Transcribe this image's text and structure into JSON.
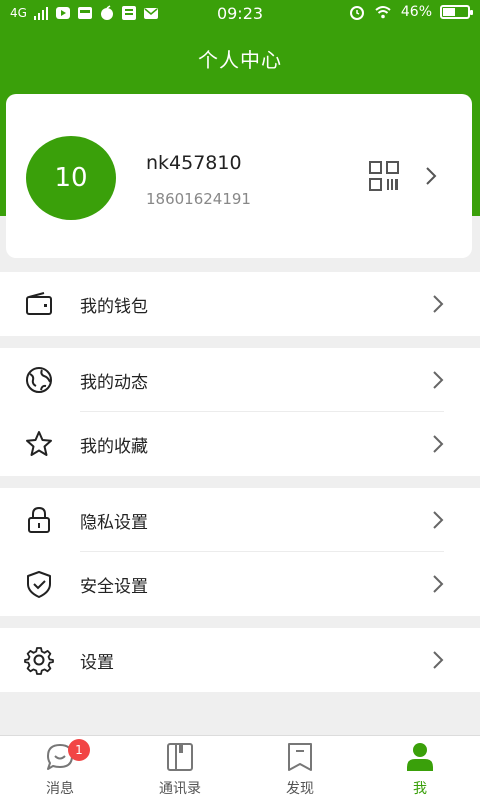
{
  "status_bar": {
    "network": "4G",
    "time": "09:23",
    "battery_percent": "46%"
  },
  "header": {
    "title": "个人中心"
  },
  "profile": {
    "avatar_text": "10",
    "username": "nk457810",
    "phone": "18601624191"
  },
  "menu": {
    "wallet": "我的钱包",
    "moments": "我的动态",
    "favorites": "我的收藏",
    "privacy": "隐私设置",
    "security": "安全设置",
    "settings": "设置"
  },
  "tabs": [
    {
      "label": "消息",
      "badge": "1",
      "icon": "chat-bubble-icon"
    },
    {
      "label": "通讯录",
      "icon": "contacts-book-icon"
    },
    {
      "label": "发现",
      "icon": "bookmark-icon"
    },
    {
      "label": "我",
      "icon": "person-icon",
      "active": true
    }
  ],
  "colors": {
    "brand_green": "#3aa00a",
    "badge_red": "#f24545"
  }
}
